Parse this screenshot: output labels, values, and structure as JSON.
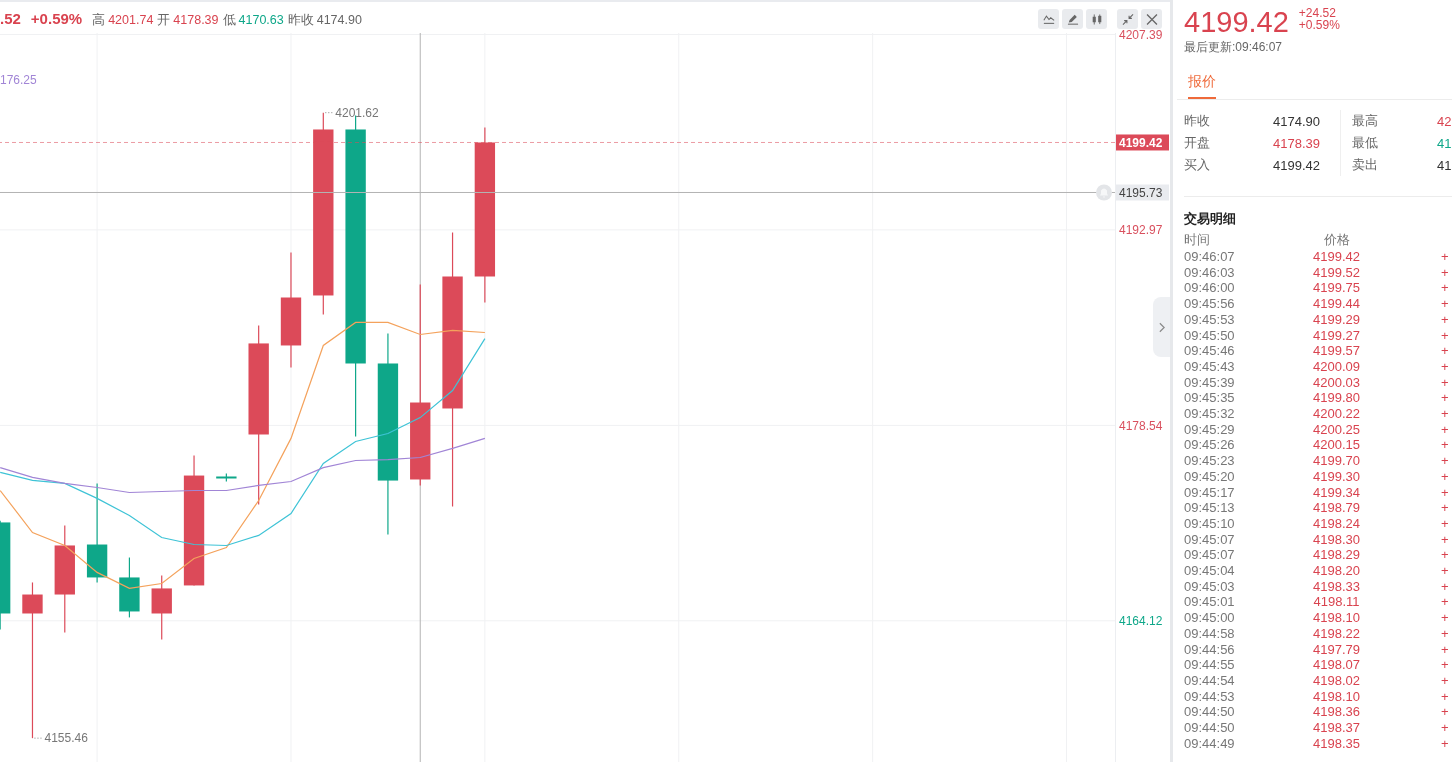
{
  "chart": {
    "header": {
      "change": ".52",
      "change_pct": "+0.59%",
      "stats": [
        {
          "label": "高",
          "value": "4201.74",
          "color": "#d9434f"
        },
        {
          "label": "开",
          "value": "4178.39",
          "color": "#d9434f"
        },
        {
          "label": "低",
          "value": "4170.63",
          "color": "#0ea789"
        },
        {
          "label": "昨收",
          "value": "4174.90",
          "color": "#666666"
        }
      ]
    },
    "ma_readout": "176.25",
    "chart_data": [
      {
        "type": "candlestick",
        "categories": [
          null,
          null,
          null,
          null,
          null,
          null,
          null,
          null,
          null,
          null,
          null,
          null,
          null,
          null,
          null,
          null,
          null,
          null,
          null,
          null,
          null,
          null,
          null,
          null,
          null,
          null,
          null,
          null,
          null,
          null,
          null,
          null,
          null,
          null,
          null
        ],
        "ohlc": [
          [
            4171.38,
            4171.5,
            4163.48,
            4164.66
          ],
          [
            4164.66,
            4166.95,
            4155.46,
            4166.06
          ],
          [
            4166.06,
            4171.15,
            4163.26,
            4169.68
          ],
          [
            4169.75,
            4174.25,
            4166.95,
            4167.32
          ],
          [
            4167.32,
            4168.79,
            4164.37,
            4164.81
          ],
          [
            4164.66,
            4167.46,
            4162.74,
            4166.51
          ],
          [
            4166.73,
            4176.32,
            4166.73,
            4174.84
          ],
          [
            4174.77,
            4174.99,
            4174.4,
            4174.7
          ],
          [
            4177.87,
            4185.92,
            4172.7,
            4184.59
          ],
          [
            4184.44,
            4191.3,
            4182.81,
            4187.98
          ],
          [
            4188.13,
            4201.62,
            4186.73,
            4200.38
          ],
          [
            4200.38,
            4201.41,
            4177.72,
            4183.11
          ],
          [
            4183.11,
            4185.32,
            4170.49,
            4174.47
          ],
          [
            4174.55,
            4188.94,
            4174.11,
            4180.23
          ],
          [
            4179.79,
            4192.78,
            4172.56,
            4189.53
          ],
          [
            4189.53,
            4200.53,
            4187.61,
            4199.42
          ],
          null,
          null,
          null,
          null,
          null,
          null,
          null,
          null,
          null,
          null,
          null,
          null,
          null,
          null,
          null,
          null,
          null,
          null,
          null
        ],
        "series": [
          {
            "type": "line",
            "color": "#f4a25c",
            "values": [
              4173.74,
              4170.64,
              4169.68,
              4167.69,
              4166.51,
              4166.87,
              4168.72,
              4169.53,
              4173.0,
              4177.58,
              4184.44,
              4186.14,
              4186.14,
              4185.25,
              4185.55,
              4185.4,
              null,
              null,
              null,
              null,
              null,
              null,
              null,
              null,
              null,
              null,
              null,
              null,
              null,
              null,
              null,
              null,
              null,
              null,
              null
            ]
          },
          {
            "type": "line",
            "color": "#3ec3d6",
            "values": [
              4175.07,
              4174.48,
              4174.26,
              4173.15,
              4171.89,
              4170.27,
              4169.75,
              4169.68,
              4170.42,
              4172.04,
              4175.73,
              4177.35,
              4177.94,
              4179.12,
              4181.12,
              4184.95,
              null,
              null,
              null,
              null,
              null,
              null,
              null,
              null,
              null,
              null,
              null,
              null,
              null,
              null,
              null,
              null,
              null,
              null,
              null
            ]
          },
          {
            "type": "line",
            "color": "#a185d6",
            "values": [
              4175.43,
              4174.7,
              4174.26,
              4173.96,
              4173.59,
              4173.66,
              4173.74,
              4173.74,
              4174.11,
              4174.4,
              4175.43,
              4175.95,
              4176.02,
              4176.17,
              4176.84,
              4177.58,
              null,
              null,
              null,
              null,
              null,
              null,
              null,
              null,
              null,
              null,
              null,
              null,
              null,
              null,
              null,
              null,
              null,
              null,
              null
            ]
          }
        ],
        "ylim": [
          4153.7,
          4207.5
        ],
        "yticks": [
          4207.39,
          4192.97,
          4178.54,
          4164.12
        ],
        "grid": true,
        "ref_lines": [
          {
            "axis": "y",
            "value": 4199.42,
            "label": "4199.42",
            "color": "#dc4a59",
            "line_style": "dashed"
          },
          {
            "axis": "y",
            "value": 4195.73,
            "label": "4195.73",
            "color": "#b4b4b4",
            "line_style": "solid"
          }
        ],
        "annotations": [
          "4201.62",
          "4155.46"
        ]
      }
    ]
  },
  "quote": {
    "price": "4199.42",
    "change": "+24.52",
    "change_pct": "+0.59%",
    "updated": "最后更新:09:46:07",
    "tabs": [
      {
        "label": "报价",
        "selected": true
      }
    ],
    "stats": [
      {
        "label": "昨收",
        "value": "4174.90",
        "color": "#333333"
      },
      {
        "label": "最高",
        "value": "42",
        "color": "#d9434f"
      },
      {
        "label": "开盘",
        "value": "4178.39",
        "color": "#d9434f"
      },
      {
        "label": "最低",
        "value": "41",
        "color": "#0ea789"
      },
      {
        "label": "买入",
        "value": "4199.42",
        "color": "#333333"
      },
      {
        "label": "卖出",
        "value": "41",
        "color": "#333333"
      }
    ]
  },
  "trades": {
    "title": "交易明细",
    "columns": [
      "时间",
      "价格"
    ],
    "rows": [
      {
        "time": "09:46:07",
        "price": "4199.42",
        "change": "+"
      },
      {
        "time": "09:46:03",
        "price": "4199.52",
        "change": "+"
      },
      {
        "time": "09:46:00",
        "price": "4199.75",
        "change": "+"
      },
      {
        "time": "09:45:56",
        "price": "4199.44",
        "change": "+"
      },
      {
        "time": "09:45:53",
        "price": "4199.29",
        "change": "+"
      },
      {
        "time": "09:45:50",
        "price": "4199.27",
        "change": "+"
      },
      {
        "time": "09:45:46",
        "price": "4199.57",
        "change": "+"
      },
      {
        "time": "09:45:43",
        "price": "4200.09",
        "change": "+"
      },
      {
        "time": "09:45:39",
        "price": "4200.03",
        "change": "+"
      },
      {
        "time": "09:45:35",
        "price": "4199.80",
        "change": "+"
      },
      {
        "time": "09:45:32",
        "price": "4200.22",
        "change": "+"
      },
      {
        "time": "09:45:29",
        "price": "4200.25",
        "change": "+"
      },
      {
        "time": "09:45:26",
        "price": "4200.15",
        "change": "+"
      },
      {
        "time": "09:45:23",
        "price": "4199.70",
        "change": "+"
      },
      {
        "time": "09:45:20",
        "price": "4199.30",
        "change": "+"
      },
      {
        "time": "09:45:17",
        "price": "4199.34",
        "change": "+"
      },
      {
        "time": "09:45:13",
        "price": "4198.79",
        "change": "+"
      },
      {
        "time": "09:45:10",
        "price": "4198.24",
        "change": "+"
      },
      {
        "time": "09:45:07",
        "price": "4198.30",
        "change": "+"
      },
      {
        "time": "09:45:07",
        "price": "4198.29",
        "change": "+"
      },
      {
        "time": "09:45:04",
        "price": "4198.20",
        "change": "+"
      },
      {
        "time": "09:45:03",
        "price": "4198.33",
        "change": "+"
      },
      {
        "time": "09:45:01",
        "price": "4198.11",
        "change": "+"
      },
      {
        "time": "09:45:00",
        "price": "4198.10",
        "change": "+"
      },
      {
        "time": "09:44:58",
        "price": "4198.22",
        "change": "+"
      },
      {
        "time": "09:44:56",
        "price": "4197.79",
        "change": "+"
      },
      {
        "time": "09:44:55",
        "price": "4198.07",
        "change": "+"
      },
      {
        "time": "09:44:54",
        "price": "4198.02",
        "change": "+"
      },
      {
        "time": "09:44:53",
        "price": "4198.10",
        "change": "+"
      },
      {
        "time": "09:44:50",
        "price": "4198.36",
        "change": "+"
      },
      {
        "time": "09:44:50",
        "price": "4198.37",
        "change": "+"
      },
      {
        "time": "09:44:49",
        "price": "4198.35",
        "change": "+"
      }
    ]
  }
}
